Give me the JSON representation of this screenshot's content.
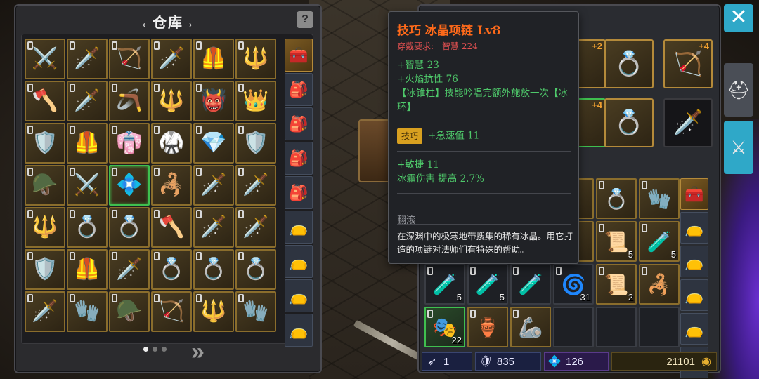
{
  "warehouse": {
    "title": "仓库",
    "title_deco_left": "‹",
    "title_deco_right": "›",
    "help_label": "?",
    "grid": [
      [
        "⚔️",
        "🗡️",
        "🏹",
        "🗡️",
        "🦺",
        "🔱"
      ],
      [
        "🪓",
        "🗡️",
        "🪃",
        "🔱",
        "👹",
        "👑"
      ],
      [
        "🛡️",
        "🦺",
        "👘",
        "🥋",
        "💎",
        "🛡️"
      ],
      [
        "🪖",
        "⚔️",
        "💠",
        "🦂",
        "🗡️",
        "🗡️"
      ],
      [
        "🔱",
        "💍",
        "💍",
        "🪓",
        "🗡️",
        "🗡️"
      ],
      [
        "🛡️",
        "🦺",
        "🗡️",
        "💍",
        "💍",
        "💍"
      ],
      [
        "🗡️",
        "🧤",
        "🪖",
        "🏹",
        "🔱",
        "🧤"
      ]
    ],
    "side_items": [
      "🧰",
      "🎒",
      "🎒",
      "🎒",
      "🎒",
      "👝",
      "👝",
      "👝",
      "👝"
    ],
    "page_dots": 3,
    "active_page": 0,
    "next_label": "»"
  },
  "inventory": {
    "equip_top": [
      {
        "glyph": "",
        "level": "+2"
      },
      {
        "glyph": "💍",
        "level": ""
      },
      {
        "glyph": "🏹",
        "level": "+4"
      }
    ],
    "equip_mid": [
      {
        "glyph": "",
        "level": "+4"
      },
      {
        "glyph": "💍",
        "level": ""
      },
      {
        "glyph": "🗡️",
        "level": ""
      }
    ],
    "rows": [
      [
        {
          "g": "",
          "c": "",
          "t": "gold"
        },
        {
          "g": "",
          "c": "",
          "t": "gold"
        },
        {
          "g": "",
          "c": "",
          "t": "gold"
        },
        {
          "g": "",
          "c": "",
          "t": "gold"
        },
        {
          "g": "💍",
          "c": "",
          "t": "gold"
        },
        {
          "g": "🧤",
          "c": "",
          "t": "gold"
        }
      ],
      [
        {
          "g": "",
          "c": "",
          "t": "gold"
        },
        {
          "g": "",
          "c": "",
          "t": "gold"
        },
        {
          "g": "",
          "c": "",
          "t": "gold"
        },
        {
          "g": "",
          "c": "",
          "t": "gold"
        },
        {
          "g": "📜",
          "c": "5",
          "t": "gold"
        },
        {
          "g": "🧪",
          "c": "5",
          "t": "gold"
        }
      ],
      [
        {
          "g": "🧪",
          "c": "5",
          "t": ""
        },
        {
          "g": "🧪",
          "c": "5",
          "t": ""
        },
        {
          "g": "🧪",
          "c": "",
          "t": ""
        },
        {
          "g": "🌀",
          "c": "31",
          "t": ""
        },
        {
          "g": "📜",
          "c": "2",
          "t": "gold"
        },
        {
          "g": "🦂",
          "c": "",
          "t": "gold"
        }
      ],
      [
        {
          "g": "🎭",
          "c": "22",
          "t": "green"
        },
        {
          "g": "🏺",
          "c": "",
          "t": "gold"
        },
        {
          "g": "🦾",
          "c": "",
          "t": "gold"
        },
        {
          "g": "",
          "c": "",
          "t": ""
        },
        {
          "g": "",
          "c": "",
          "t": ""
        },
        {
          "g": "",
          "c": "",
          "t": ""
        }
      ]
    ],
    "side_items": [
      "🧰",
      "👝",
      "👝",
      "👝",
      "👝",
      "👝"
    ],
    "status": {
      "level_value": "1",
      "points_value": "835",
      "gems_value": "126",
      "gold_value": "21101"
    }
  },
  "tooltip": {
    "name": "技巧 冰晶项链 Lv8",
    "req_label": "穿戴要求:",
    "req_stat": "智慧 224",
    "base_stats": [
      "+智慧 23",
      "+火焰抗性 76",
      "【冰锥柱】技能吟唱完额外施放一次【冰环】"
    ],
    "skill_badge": "技巧",
    "skill_stat": "+急速值 11",
    "extra_stats": [
      "+敏捷 11",
      "冰霜伤害 提高 2.7%"
    ],
    "roll_label": "翻滚",
    "description": "在深渊中的极寒地带搜集的稀有冰晶。用它打造的项链对法师们有特殊的帮助。"
  },
  "side_tabs": {
    "close_label": "✕"
  },
  "colors": {
    "item_name": "#ff6a1a",
    "stat_green": "#4ec86a",
    "requirement_red": "#e05050",
    "slot_gold_border": "#8a6d2c",
    "accent_teal": "#2fa8c8"
  }
}
